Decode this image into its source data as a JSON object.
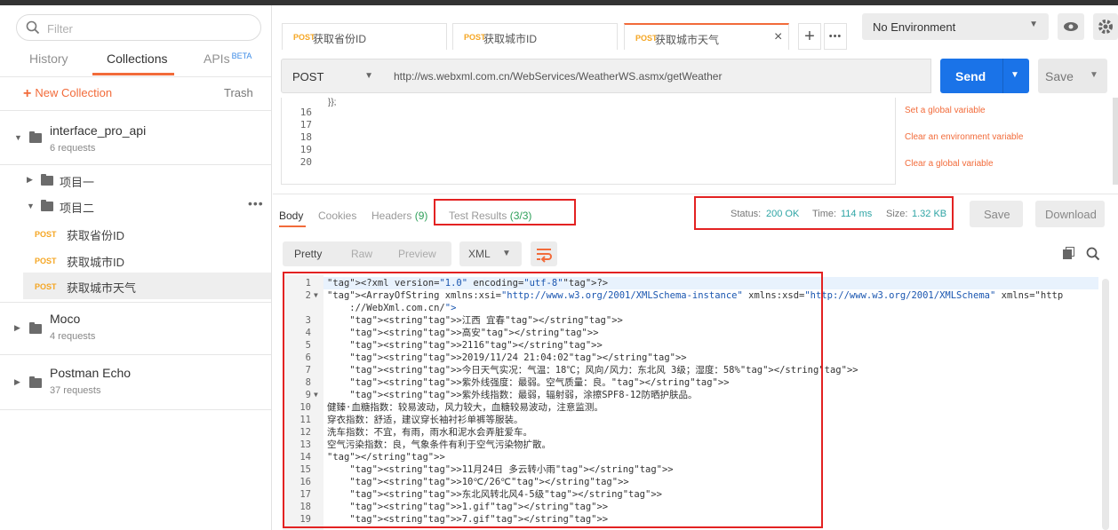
{
  "sidebar": {
    "search_placeholder": "Filter",
    "tabs": {
      "history": "History",
      "collections": "Collections",
      "apis": "APIs",
      "apis_badge": "BETA"
    },
    "new_collection": "New Collection",
    "trash": "Trash",
    "collections": [
      {
        "name": "interface_pro_api",
        "sub": "6 requests"
      },
      {
        "name": "Moco",
        "sub": "4 requests"
      },
      {
        "name": "Postman Echo",
        "sub": "37 requests"
      }
    ],
    "folders": [
      "项目一",
      "项目二"
    ],
    "requests": [
      {
        "method": "POST",
        "name": "获取省份ID"
      },
      {
        "method": "POST",
        "name": "获取城市ID"
      },
      {
        "method": "POST",
        "name": "获取城市天气"
      }
    ]
  },
  "tabs": [
    {
      "method": "POST",
      "title": "获取省份ID"
    },
    {
      "method": "POST",
      "title": "获取城市ID"
    },
    {
      "method": "POST",
      "title": "获取城市天气"
    }
  ],
  "environment": "No Environment",
  "request": {
    "method": "POST",
    "url": "http://ws.webxml.com.cn/WebServices/WeatherWS.asmx/getWeather",
    "send": "Send",
    "save": "Save"
  },
  "editor": {
    "lines": [
      "16",
      "17",
      "18",
      "19",
      "20"
    ],
    "snippets": [
      "Set a global variable",
      "Clear an environment variable",
      "Clear a global variable"
    ]
  },
  "response": {
    "tabs": {
      "body": "Body",
      "cookies": "Cookies",
      "headers": "Headers",
      "headers_count": "(9)",
      "tests": "Test Results",
      "tests_count": "(3/3)"
    },
    "status_label": "Status:",
    "status": "200 OK",
    "time_label": "Time:",
    "time": "114 ms",
    "size_label": "Size:",
    "size": "1.32 KB",
    "save": "Save",
    "download": "Download",
    "formats": {
      "pretty": "Pretty",
      "raw": "Raw",
      "preview": "Preview"
    },
    "lang": "XML"
  },
  "code": {
    "l1": {
      "n": "1",
      "t": "<?xml version=\"1.0\" encoding=\"utf-8\"?>"
    },
    "l2a": {
      "n": "2",
      "t": "<ArrayOfString xmlns:xsi=\"http://www.w3.org/2001/XMLSchema-instance\" xmlns:xsd=\"http://www.w3.org/2001/XMLSchema\" xmlns=\"http"
    },
    "l2b": {
      "t": "    ://WebXml.com.cn/\">"
    },
    "l3": {
      "n": "3",
      "t": "    <string>江西 宜春</string>"
    },
    "l4": {
      "n": "4",
      "t": "    <string>高安</string>"
    },
    "l5": {
      "n": "5",
      "t": "    <string>2116</string>"
    },
    "l6": {
      "n": "6",
      "t": "    <string>2019/11/24 21:04:02</string>"
    },
    "l7": {
      "n": "7",
      "t": "    <string>今日天气实况：气温：18℃；风向/风力：东北风 3级；湿度：58%</string>"
    },
    "l8": {
      "n": "8",
      "t": "    <string>紫外线强度：最弱。空气质量：良。</string>"
    },
    "l9": {
      "n": "9",
      "t": "    <string>紫外线指数：最弱，辐射弱，涂擦SPF8-12防晒护肤品。"
    },
    "l10": {
      "n": "10",
      "t": "健臻·血糖指数：较易波动，风力较大，血糖较易波动，注意监测。"
    },
    "l11": {
      "n": "11",
      "t": "穿衣指数：舒适，建议穿长袖衬衫单裤等服装。"
    },
    "l12": {
      "n": "12",
      "t": "洗车指数：不宜，有雨，雨水和泥水会弄脏爱车。"
    },
    "l13": {
      "n": "13",
      "t": "空气污染指数：良，气象条件有利于空气污染物扩散。"
    },
    "l14": {
      "n": "14",
      "t": "</string>"
    },
    "l15": {
      "n": "15",
      "t": "    <string>11月24日 多云转小雨</string>"
    },
    "l16": {
      "n": "16",
      "t": "    <string>10℃/26℃</string>"
    },
    "l17": {
      "n": "17",
      "t": "    <string>东北风转北风4-5级</string>"
    },
    "l18": {
      "n": "18",
      "t": "    <string>1.gif</string>"
    },
    "l19": {
      "n": "19",
      "t": "    <string>7.gif</string>"
    }
  }
}
